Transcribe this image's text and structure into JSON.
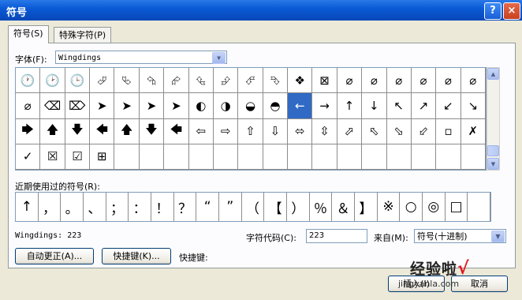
{
  "window": {
    "title": "符号",
    "help_label": "?",
    "close_label": "×"
  },
  "tabs": [
    {
      "label": "符号(S)"
    },
    {
      "label": "特殊字符(P)"
    }
  ],
  "font": {
    "label": "字体(F):",
    "value": "Wingdings"
  },
  "symbols": [
    "🕐",
    "🕑",
    "🕒",
    "⮰",
    "⮱",
    "⮲",
    "⮳",
    "⮴",
    "⮵",
    "⮶",
    "⮷",
    "❖",
    "⊠",
    "⌀",
    "⌀",
    "⌀",
    "⌀",
    "⌀",
    "⌀",
    "⌀",
    "⌫",
    "⌦",
    "➤",
    "➤",
    "➤",
    "➤",
    "◐",
    "◑",
    "◒",
    "◓",
    "←",
    "→",
    "↑",
    "↓",
    "↖",
    "↗",
    "↙",
    "↘",
    "🡆",
    "🡅",
    "🡇",
    "🡄",
    "🡅",
    "🡇",
    "🡄",
    "⇦",
    "⇨",
    "⇧",
    "⇩",
    "⬄",
    "⇳",
    "⬀",
    "⬁",
    "⬂",
    "⬃",
    "▫",
    "✗",
    "✓",
    "☒",
    "☑",
    "⊞",
    "",
    "",
    "",
    "",
    "",
    "",
    "",
    "",
    "",
    "",
    "",
    "",
    "",
    "",
    ""
  ],
  "selected_index": 30,
  "recent": {
    "label": "近期使用过的符号(R):",
    "items": [
      "↑",
      "，",
      "。",
      "、",
      "；",
      "：",
      "！",
      "？",
      "“",
      "”",
      "（",
      "【",
      "）",
      "％",
      "＆",
      "】",
      "※",
      "○",
      "◎",
      "□",
      ""
    ]
  },
  "status": {
    "font_code": "Wingdings: 223"
  },
  "char_code": {
    "label": "字符代码(C):",
    "value": "223"
  },
  "from": {
    "label": "来自(M):",
    "value": "符号(十进制)"
  },
  "buttons": {
    "autocorrect": "自动更正(A)...",
    "shortcut_key": "快捷键(K)...",
    "shortcut_label": "快捷键:",
    "insert": "插入(I)",
    "cancel": "取消"
  },
  "watermark": {
    "text": "经验啦",
    "check": "√",
    "url": "jingyanla.com"
  }
}
